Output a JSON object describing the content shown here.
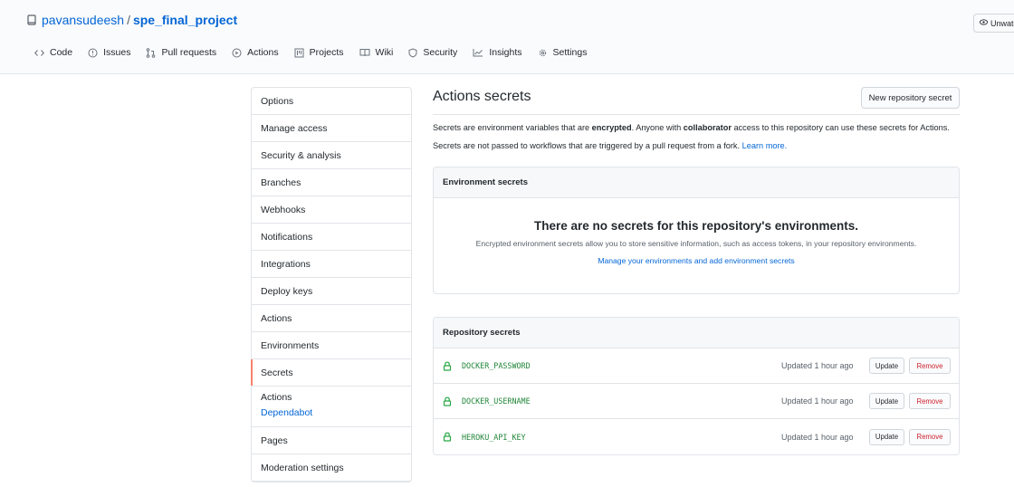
{
  "repo": {
    "owner": "pavansudeesh",
    "separator": "/",
    "name": "spe_final_project",
    "watch_label": "Unwatch"
  },
  "tabs": [
    {
      "label": "Code",
      "icon": "code-icon"
    },
    {
      "label": "Issues",
      "icon": "issue-icon"
    },
    {
      "label": "Pull requests",
      "icon": "pull-request-icon"
    },
    {
      "label": "Actions",
      "icon": "play-icon"
    },
    {
      "label": "Projects",
      "icon": "project-icon"
    },
    {
      "label": "Wiki",
      "icon": "book-icon"
    },
    {
      "label": "Security",
      "icon": "shield-icon"
    },
    {
      "label": "Insights",
      "icon": "graph-icon"
    },
    {
      "label": "Settings",
      "icon": "gear-icon"
    }
  ],
  "sidebar": {
    "items": [
      "Options",
      "Manage access",
      "Security & analysis",
      "Branches",
      "Webhooks",
      "Notifications",
      "Integrations",
      "Deploy keys",
      "Actions",
      "Environments",
      "Secrets"
    ],
    "group": {
      "heading": "Actions",
      "sub": "Dependabot"
    },
    "after": [
      "Pages",
      "Moderation settings"
    ]
  },
  "main": {
    "title": "Actions secrets",
    "new_secret_button": "New repository secret",
    "desc1_a": "Secrets are environment variables that are ",
    "desc1_b": "encrypted",
    "desc1_c": ". Anyone with ",
    "desc1_d": "collaborator",
    "desc1_e": " access to this repository can use these secrets for Actions.",
    "desc2": "Secrets are not passed to workflows that are triggered by a pull request from a fork. ",
    "desc2_link": "Learn more."
  },
  "environment_secrets": {
    "header": "Environment secrets",
    "blank_title": "There are no secrets for this repository's environments.",
    "blank_desc": "Encrypted environment secrets allow you to store sensitive information, such as access tokens, in your repository environments.",
    "blank_link": "Manage your environments and add environment secrets"
  },
  "repository_secrets": {
    "header": "Repository secrets",
    "rows": [
      {
        "name": "DOCKER_PASSWORD",
        "updated": "Updated 1 hour ago",
        "update": "Update",
        "remove": "Remove"
      },
      {
        "name": "DOCKER_USERNAME",
        "updated": "Updated 1 hour ago",
        "update": "Update",
        "remove": "Remove"
      },
      {
        "name": "HEROKU_API_KEY",
        "updated": "Updated 1 hour ago",
        "update": "Update",
        "remove": "Remove"
      }
    ]
  },
  "colors": {
    "link": "#0366d6",
    "secret_name": "#22863a",
    "lock": "#28a745",
    "remove": "#cb2431",
    "selected_accent": "#f9826c"
  }
}
